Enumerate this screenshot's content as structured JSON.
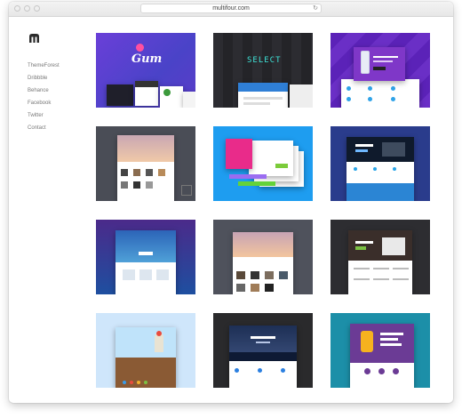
{
  "browser": {
    "url": "multifour.com"
  },
  "sidebar": {
    "nav": [
      "ThemeForest",
      "Dribbble",
      "Behance",
      "Facebook",
      "Twitter",
      "Contact"
    ]
  },
  "tiles": {
    "gum_title": "Gum",
    "select_title": "SELECT"
  },
  "icons": {
    "logo": "multifour-logo-icon",
    "reload": "reload-icon"
  },
  "colors": {
    "accent_purple": "#5b3fd1",
    "accent_blue": "#1ea0f0",
    "dark": "#2b2b2b"
  }
}
